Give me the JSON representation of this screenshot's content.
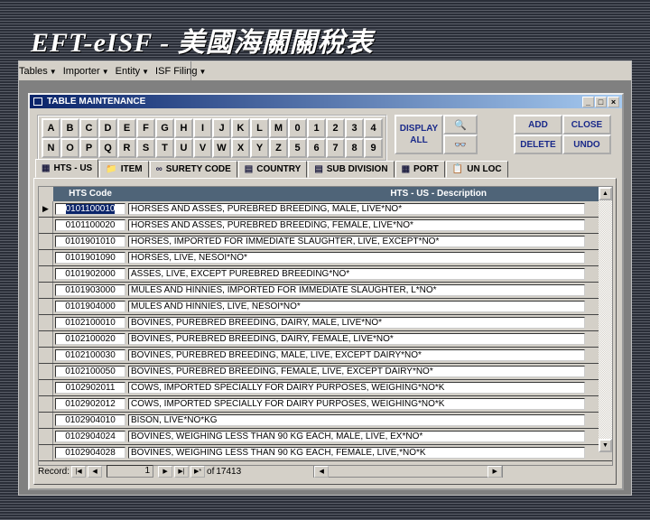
{
  "title": "EFT-eISF - 美國海關關稅表",
  "menu": [
    "Tables",
    "Importer",
    "Entity",
    "ISF Filing"
  ],
  "form": {
    "title": "TABLE MAINTENANCE"
  },
  "letters_row1": [
    "A",
    "B",
    "C",
    "D",
    "E",
    "F",
    "G",
    "H",
    "I",
    "J",
    "K",
    "L",
    "M",
    "0",
    "1",
    "2",
    "3",
    "4"
  ],
  "letters_row2": [
    "N",
    "O",
    "P",
    "Q",
    "R",
    "S",
    "T",
    "U",
    "V",
    "W",
    "X",
    "Y",
    "Z",
    "5",
    "6",
    "7",
    "8",
    "9"
  ],
  "buttons": {
    "display_all_1": "DISPLAY",
    "display_all_2": "ALL",
    "add": "ADD",
    "close": "CLOSE",
    "delete": "DELETE",
    "undo": "UNDO"
  },
  "tabs": [
    {
      "label": "HTS - US",
      "icon": "table-icon"
    },
    {
      "label": "ITEM",
      "icon": "folder-icon"
    },
    {
      "label": "SURETY CODE",
      "icon": "glasses-icon"
    },
    {
      "label": "COUNTRY",
      "icon": "form-icon"
    },
    {
      "label": "SUB DIVISION",
      "icon": "form-icon"
    },
    {
      "label": "PORT",
      "icon": "calendar-icon"
    },
    {
      "label": "UN LOC",
      "icon": "clipboard-icon"
    }
  ],
  "grid": {
    "headers": [
      "HTS Code",
      "HTS - US -  Description"
    ],
    "rows": [
      {
        "code": "0101100010",
        "desc": "HORSES AND ASSES, PUREBRED BREEDING, MALE, LIVE*NO*"
      },
      {
        "code": "0101100020",
        "desc": "HORSES AND ASSES, PUREBRED BREEDING, FEMALE, LIVE*NO*"
      },
      {
        "code": "0101901010",
        "desc": "HORSES, IMPORTED FOR IMMEDIATE SLAUGHTER, LIVE, EXCEPT*NO*"
      },
      {
        "code": "0101901090",
        "desc": "HORSES, LIVE, NESOI*NO*"
      },
      {
        "code": "0101902000",
        "desc": "ASSES, LIVE, EXCEPT PUREBRED BREEDING*NO*"
      },
      {
        "code": "0101903000",
        "desc": "MULES AND HINNIES, IMPORTED FOR IMMEDIATE SLAUGHTER, L*NO*"
      },
      {
        "code": "0101904000",
        "desc": "MULES AND HINNIES, LIVE, NESOI*NO*"
      },
      {
        "code": "0102100010",
        "desc": "BOVINES, PUREBRED BREEDING, DAIRY, MALE, LIVE*NO*"
      },
      {
        "code": "0102100020",
        "desc": "BOVINES, PUREBRED BREEDING, DAIRY, FEMALE, LIVE*NO*"
      },
      {
        "code": "0102100030",
        "desc": "BOVINES, PUREBRED BREEDING, MALE, LIVE, EXCEPT DAIRY*NO*"
      },
      {
        "code": "0102100050",
        "desc": "BOVINES, PUREBRED BREEDING, FEMALE, LIVE, EXCEPT DAIRY*NO*"
      },
      {
        "code": "0102902011",
        "desc": "COWS, IMPORTED SPECIALLY FOR DAIRY PURPOSES, WEIGHING*NO*K"
      },
      {
        "code": "0102902012",
        "desc": "COWS, IMPORTED SPECIALLY FOR DAIRY PURPOSES, WEIGHING*NO*K"
      },
      {
        "code": "0102904010",
        "desc": "BISON, LIVE*NO*KG"
      },
      {
        "code": "0102904024",
        "desc": "BOVINES, WEIGHING LESS THAN 90 KG EACH, MALE, LIVE, EX*NO*"
      },
      {
        "code": "0102904028",
        "desc": "BOVINES, WEIGHING LESS THAN 90 KG EACH, FEMALE, LIVE,*NO*K"
      }
    ]
  },
  "record": {
    "label": "Record:",
    "current": "1",
    "of_label": "of",
    "total": "17413"
  }
}
